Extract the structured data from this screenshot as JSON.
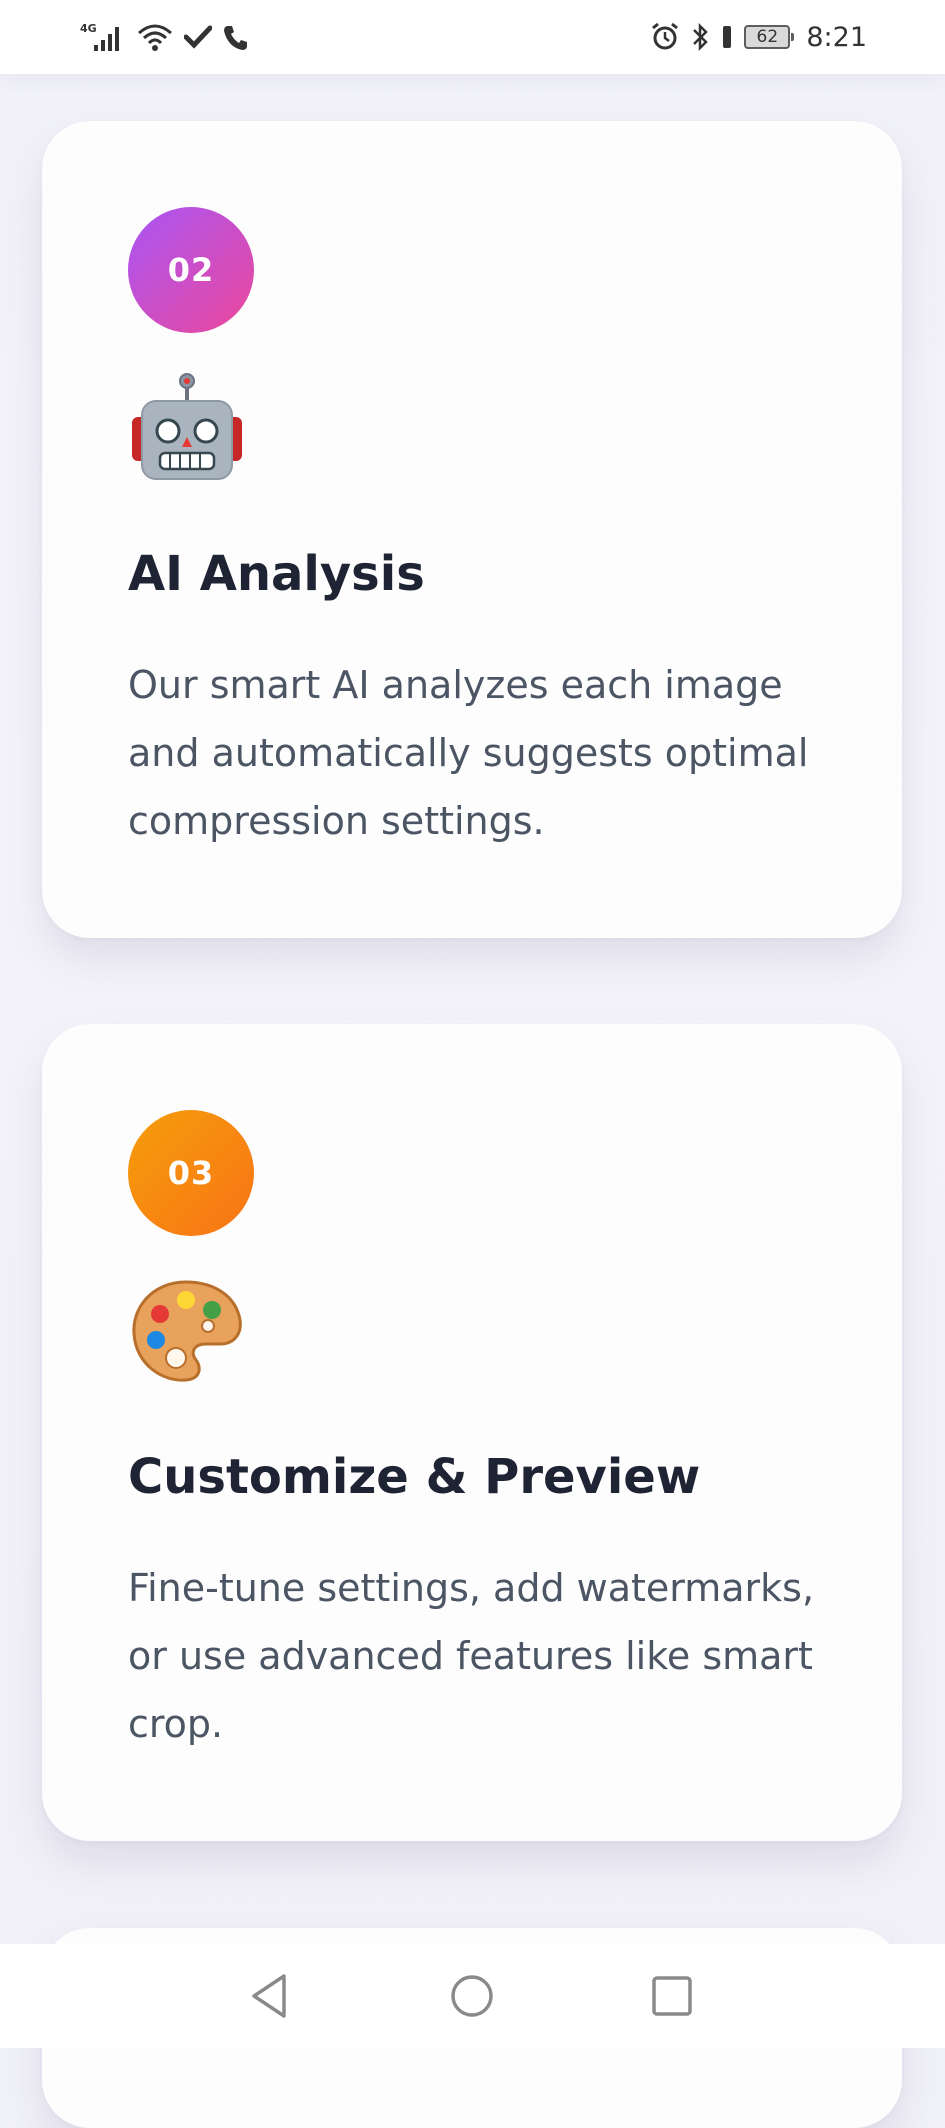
{
  "status_bar": {
    "network": "4G",
    "battery": "62",
    "time": "8:21"
  },
  "cards": [
    {
      "step": "02",
      "icon": "robot-icon",
      "title": "AI Analysis",
      "description": "Our smart AI analyzes each image and automatically suggests optimal compression settings."
    },
    {
      "step": "03",
      "icon": "palette-icon",
      "title": "Customize & Preview",
      "description": "Fine-tune settings, add watermarks, or use advanced features like smart crop."
    }
  ],
  "colors": {
    "badge_02_start": "#a855f7",
    "badge_02_end": "#ec4899",
    "badge_03_start": "#f59e0b",
    "badge_03_end": "#f97316",
    "title": "#1e2433",
    "description": "#4b5563"
  },
  "nav_bar": {
    "back_icon": "back-triangle-icon",
    "home_icon": "home-circle-icon",
    "recent_icon": "recent-square-icon"
  }
}
